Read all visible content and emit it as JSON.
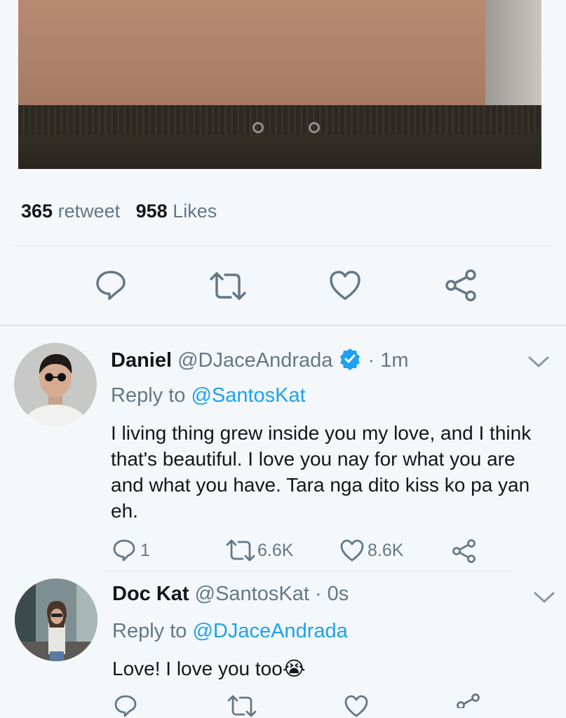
{
  "stats": {
    "retweet_count": "365",
    "retweet_label": "retweet",
    "like_count": "958",
    "like_label": "Likes"
  },
  "icons": {
    "reply": "reply-icon",
    "retweet": "retweet-icon",
    "like": "heart-icon",
    "share": "share-icon",
    "verified": "verified-badge-icon",
    "more": "chevron-down-icon"
  },
  "colors": {
    "background": "#f5f8fa",
    "text": "#14171a",
    "secondary": "#657786",
    "accent": "#1da1f2"
  },
  "replies": [
    {
      "name": "Daniel",
      "handle": "@DJaceAndrada",
      "time": "· 1m",
      "reply_to_label": "Reply to",
      "reply_to_handle": "@SantosKat",
      "text": "I living thing grew inside you my love, and I think that's beautiful. I love you nay for what you are and what you have. Tara nga dito kiss ko pa yan eh.",
      "reply_count": "1",
      "retweet_count": "6.6K",
      "like_count": "8.6K"
    },
    {
      "name": "Doc Kat",
      "handle": "@SantosKat",
      "time": "· 0s",
      "reply_to_label": "Reply to",
      "reply_to_handle": "@DJaceAndrada",
      "text": "Love! I love you too",
      "emoji": "😭"
    }
  ]
}
